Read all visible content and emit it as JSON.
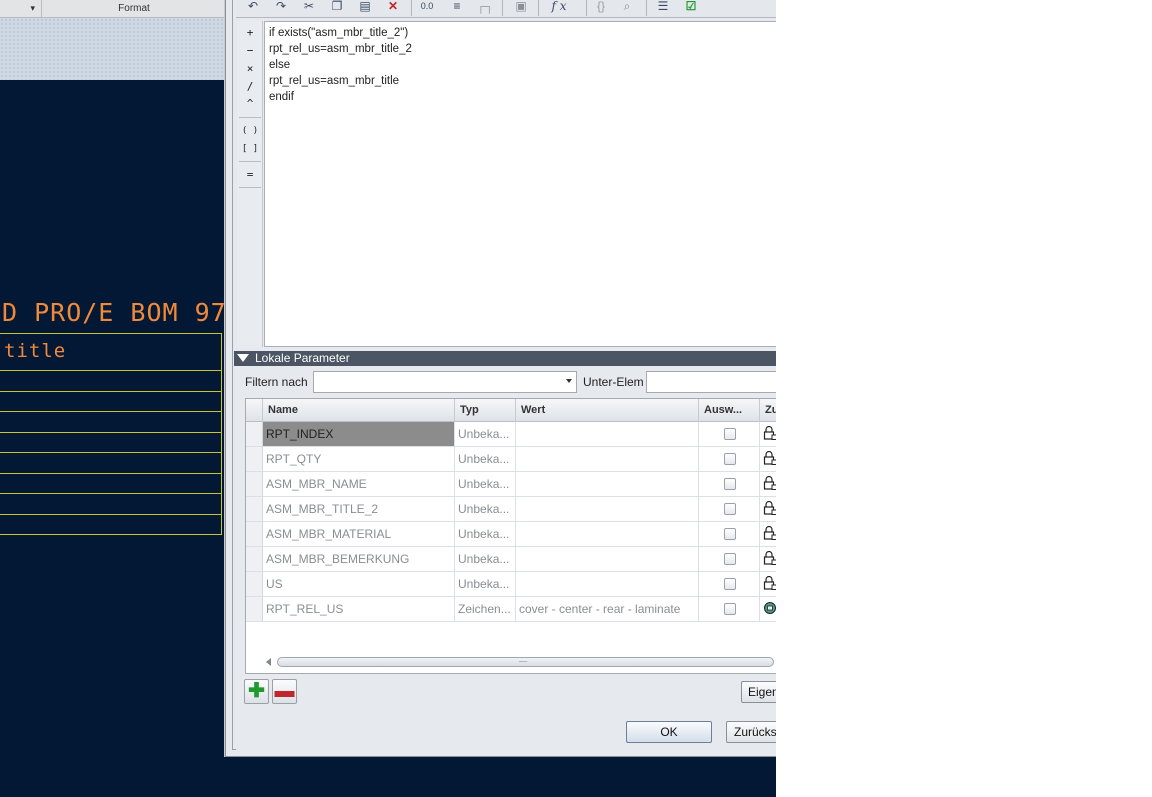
{
  "background_app": {
    "ribbon": {
      "dropdown_glyph": "▾",
      "format_label": "Format"
    },
    "drawing": {
      "header_text": "D PRO/E BOM 97",
      "title_text": "title",
      "line_color": "#c8c42c",
      "text_color": "#f08a3a",
      "bg_color": "#031834"
    }
  },
  "dialog": {
    "toolbar": {
      "icons": [
        "undo-icon",
        "redo-icon",
        "cut-icon",
        "copy-icon",
        "paste-icon",
        "delete-icon",
        "units-icon",
        "parameter-icon",
        "insert-parameter-icon",
        "select-icon",
        "function-icon",
        "braces-icon",
        "search-icon",
        "sort-icon",
        "verify-icon"
      ],
      "function_glyph": "f x"
    },
    "operators": [
      "+",
      "−",
      "×",
      "/",
      "^",
      "( )",
      "[ ]",
      "="
    ],
    "editor": {
      "lines": [
        "if exists(\"asm_mbr_title_2\")",
        "rpt_rel_us=asm_mbr_title_2",
        "else",
        "rpt_rel_us=asm_mbr_title",
        "endif"
      ]
    },
    "local_params": {
      "header": "Lokale Parameter",
      "filter_label": "Filtern nach",
      "filter_value": "",
      "sub_element_label": "Unter-Elem",
      "sub_element_value": "",
      "columns": [
        "Name",
        "Typ",
        "Wert",
        "Ausw...",
        "Zu"
      ],
      "rows": [
        {
          "name": "RPT_INDEX",
          "typ": "Unbeka...",
          "wert": "",
          "selected": true,
          "icon": "lock-icon"
        },
        {
          "name": "RPT_QTY",
          "typ": "Unbeka...",
          "wert": "",
          "selected": false,
          "icon": "lock-icon"
        },
        {
          "name": "ASM_MBR_NAME",
          "typ": "Unbeka...",
          "wert": "",
          "selected": false,
          "icon": "lock-icon"
        },
        {
          "name": "ASM_MBR_TITLE_2",
          "typ": "Unbeka...",
          "wert": "",
          "selected": false,
          "icon": "lock-icon"
        },
        {
          "name": "ASM_MBR_MATERIAL",
          "typ": "Unbeka...",
          "wert": "",
          "selected": false,
          "icon": "lock-icon"
        },
        {
          "name": "ASM_MBR_BEMERKUNG",
          "typ": "Unbeka...",
          "wert": "",
          "selected": false,
          "icon": "lock-icon"
        },
        {
          "name": "US",
          "typ": "Unbeka...",
          "wert": "",
          "selected": false,
          "icon": "lock-icon"
        },
        {
          "name": "RPT_REL_US",
          "typ": "Zeichen...",
          "wert": "cover - center - rear - laminate",
          "selected": false,
          "icon": "relation-icon"
        }
      ],
      "scroll_grip": "┈┈",
      "add_glyph": "✚",
      "remove_glyph": "▬"
    },
    "buttons": {
      "eigen": "Eigen",
      "ok": "OK",
      "zurueck": "Zurücks"
    }
  }
}
